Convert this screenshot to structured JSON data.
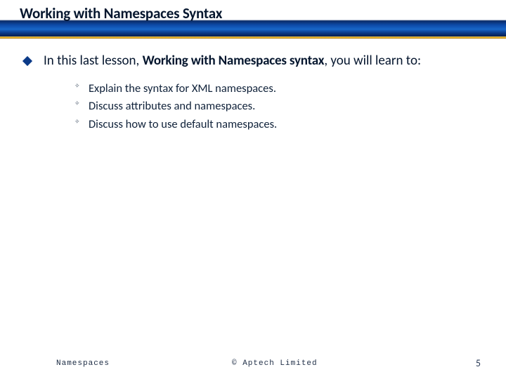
{
  "header": {
    "title": "Working with Namespaces Syntax"
  },
  "lead": {
    "pre": "In this last lesson, ",
    "topic": "Working with Namespaces syntax",
    "post": ", you will learn to:"
  },
  "sub_items": [
    "Explain the syntax for XML namespaces.",
    "Discuss attributes and namespaces.",
    "Discuss how to use default namespaces."
  ],
  "footer": {
    "left": "Namespaces",
    "center": "© Aptech Limited",
    "page": "5"
  }
}
